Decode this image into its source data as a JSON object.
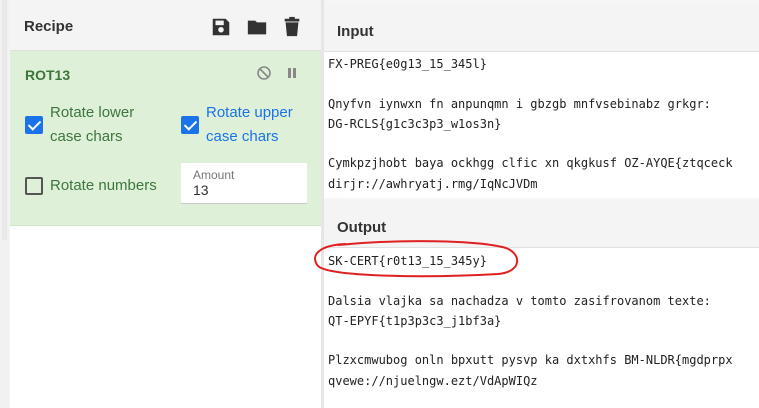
{
  "recipe": {
    "title": "Recipe",
    "operation": {
      "name": "ROT13",
      "rotate_lower_label": "Rotate lower case chars",
      "rotate_lower_line1": "Rotate lower",
      "rotate_lower_line2": "case chars",
      "rotate_lower_checked": true,
      "rotate_upper_line1": "Rotate upper",
      "rotate_upper_line2": "case chars",
      "rotate_upper_checked": true,
      "rotate_numbers_label": "Rotate numbers",
      "rotate_numbers_checked": false,
      "amount_label": "Amount",
      "amount_value": "13"
    },
    "header_icons": [
      "save-icon",
      "folder-icon",
      "trash-icon"
    ]
  },
  "input": {
    "title": "Input",
    "lines": [
      "FX-PREG{e0g13_15_345l}",
      "",
      "Qnyfvn iynwxn fn anpunqmn i gbzgb mnfvsebinabz grkgr:",
      "DG-RCLS{g1c3c3p3_w1os3n}",
      "",
      "Cymkpzjhobt baya ockhgg clfic xn qkgkusf OZ-AYQE{ztqceck",
      "dirjr://awhryatj.rmg/IqNcJVDm"
    ]
  },
  "output": {
    "title": "Output",
    "lines": [
      "SK-CERT{r0t13_15_345y}",
      "",
      "Dalsia vlajka sa nachadza v tomto zasifrovanom texte:",
      "QT-EPYF{t1p3p3c3_j1bf3a}",
      "",
      "Plzxcmwubog onln bpxutt pysvp ka dxtxhfs BM-NLDR{mgdprpx",
      "qvewe://njuelngw.ezt/VdApWIQz"
    ]
  },
  "colors": {
    "accent_blue": "#1a73e8",
    "op_green_bg": "#dff0d8",
    "op_green_text": "#3c763d",
    "annotation_red": "#e02020"
  }
}
